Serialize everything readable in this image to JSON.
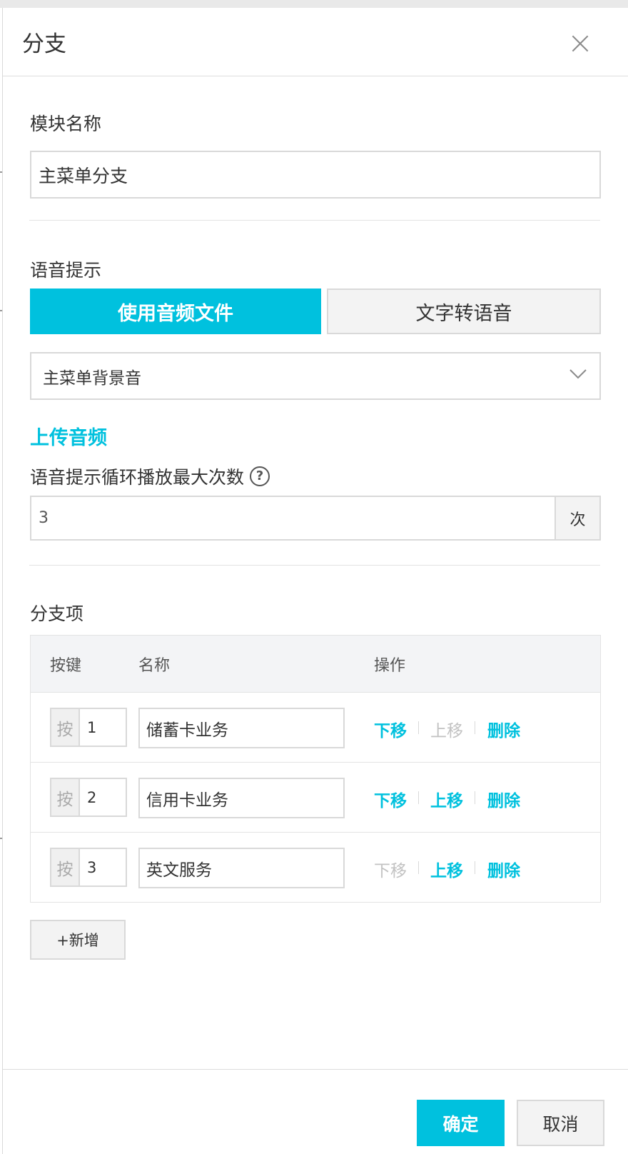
{
  "dialog": {
    "title": "分支",
    "close_icon": "close-icon"
  },
  "module_name": {
    "label": "模块名称",
    "value": "主菜单分支"
  },
  "voice_prompt": {
    "label": "语音提示",
    "tabs": [
      {
        "label": "使用音频文件",
        "active": true
      },
      {
        "label": "文字转语音",
        "active": false
      }
    ],
    "audio_select_value": "主菜单背景音",
    "upload_link": "上传音频",
    "loop_label": "语音提示循环播放最大次数",
    "help_icon_glyph": "?",
    "loop_value": "3",
    "loop_unit": "次"
  },
  "branch_items": {
    "label": "分支项",
    "columns": [
      "按键",
      "名称",
      "操作"
    ],
    "key_prefix": "按",
    "rows": [
      {
        "key": "1",
        "name": "储蓄卡业务",
        "move_down": "下移",
        "move_up": "上移",
        "delete": "删除",
        "down_enabled": true,
        "up_enabled": false
      },
      {
        "key": "2",
        "name": "信用卡业务",
        "move_down": "下移",
        "move_up": "上移",
        "delete": "删除",
        "down_enabled": true,
        "up_enabled": true
      },
      {
        "key": "3",
        "name": "英文服务",
        "move_down": "下移",
        "move_up": "上移",
        "delete": "删除",
        "down_enabled": false,
        "up_enabled": true
      }
    ],
    "add_button": "+新增"
  },
  "footer": {
    "confirm": "确定",
    "cancel": "取消"
  },
  "colors": {
    "accent": "#00c1de",
    "disabled": "#c2c2c2",
    "border": "#d9d9d9"
  }
}
